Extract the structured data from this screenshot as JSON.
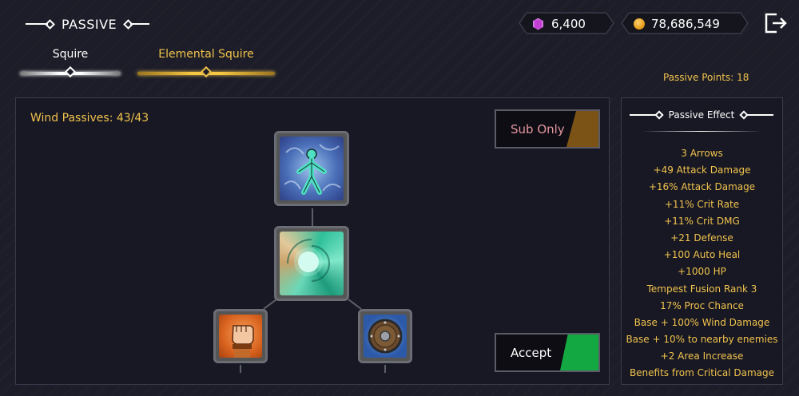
{
  "header": {
    "title": "PASSIVE",
    "gems": "6,400",
    "coins": "78,686,549"
  },
  "tabs": [
    {
      "label": "Squire",
      "active": false
    },
    {
      "label": "Elemental Squire",
      "active": true
    }
  ],
  "passive_points": "Passive Points: 18",
  "tree": {
    "title": "Wind Passives: 43/43",
    "nodes": [
      {
        "name": "wind-figure",
        "icon": "wind-figure-icon"
      },
      {
        "name": "wind-vortex",
        "icon": "vortex-icon"
      },
      {
        "name": "fist",
        "icon": "fist-icon"
      },
      {
        "name": "shield",
        "icon": "round-shield-icon"
      }
    ]
  },
  "buttons": {
    "sub_only": "Sub Only",
    "accept": "Accept"
  },
  "effect": {
    "title": "Passive Effect",
    "items": [
      "3 Arrows",
      "+49 Attack Damage",
      "+16% Attack Damage",
      "+11% Crit Rate",
      "+11% Crit DMG",
      "+21 Defense",
      "+100 Auto Heal",
      "+1000 HP",
      "Tempest Fusion Rank 3",
      "17% Proc Chance",
      "Base + 100% Wind Damage",
      "Base + 10% to nearby enemies",
      "+2 Area Increase",
      "Benefits from Critical Damage"
    ]
  },
  "colors": {
    "gold": "#f1c24b",
    "accept": "#14a843",
    "sub_only": "#7b5316",
    "sub_only_text": "#e4959e"
  }
}
